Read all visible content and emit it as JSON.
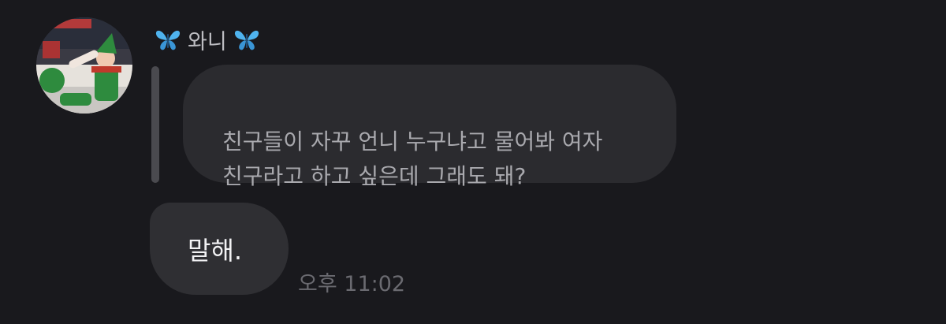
{
  "sender": {
    "name": "와니",
    "icon_left": "butterfly-icon",
    "icon_right": "butterfly-icon",
    "icon_color": "#4fb3ee"
  },
  "quoted_message": {
    "text": "친구들이 자꾸 언니 누구냐고 물어봐 여자\n친구라고 하고 싶은데 그래도 돼?"
  },
  "reply_message": {
    "text": "말해."
  },
  "timestamp": "오후 11:02"
}
